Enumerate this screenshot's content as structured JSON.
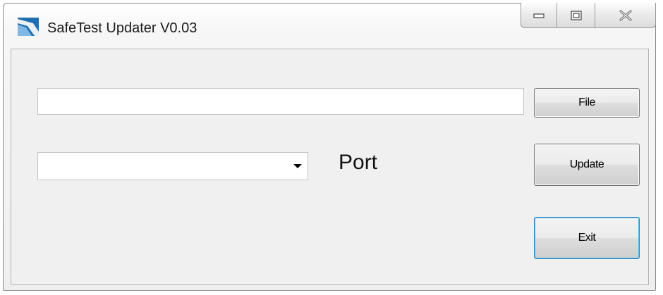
{
  "window": {
    "title": "SafeTest Updater V0.03",
    "icon": "app-logo-icon"
  },
  "caption_buttons": {
    "minimize_icon": "minimize-icon",
    "maximize_icon": "maximize-icon",
    "close_icon": "close-icon"
  },
  "file_path": {
    "value": "",
    "placeholder": ""
  },
  "buttons": {
    "file_label": "File",
    "update_label": "Update",
    "exit_label": "Exit"
  },
  "port": {
    "selected_value": "",
    "label": "Port"
  },
  "colors": {
    "focus_border": "#3c7fb1",
    "focus_glow": "#48c0f0",
    "icon_blue": "#1f6fb0"
  }
}
